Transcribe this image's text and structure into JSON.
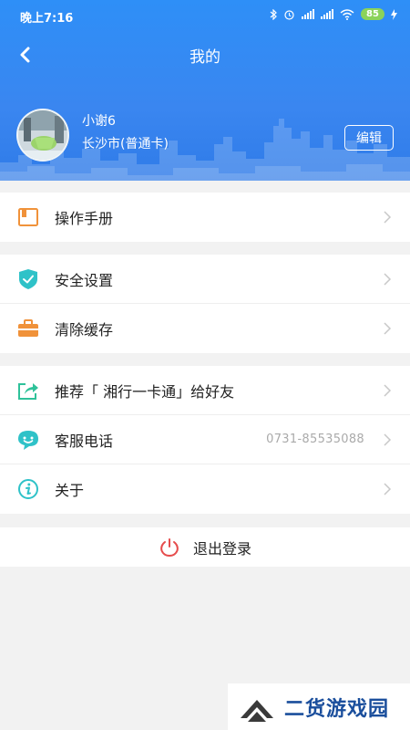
{
  "status_bar": {
    "time": "晚上7:16",
    "battery": "85",
    "icons": [
      "bluetooth-icon",
      "alarm-icon",
      "signal-icon",
      "signal-icon",
      "wifi-icon",
      "battery-icon",
      "charging-icon"
    ]
  },
  "header": {
    "title": "我的",
    "back_icon": "back-arrow-icon"
  },
  "profile": {
    "name": "小谢6",
    "card": "长沙市(普通卡)",
    "edit_label": "编辑"
  },
  "menu_groups": [
    [
      {
        "label": "操作手册",
        "icon": "manual-icon",
        "icon_color": "#f0923a"
      }
    ],
    [
      {
        "label": "安全设置",
        "icon": "shield-icon",
        "icon_color": "#2fc2c8"
      },
      {
        "label": "清除缓存",
        "icon": "briefcase-icon",
        "icon_color": "#f0923a"
      }
    ],
    [
      {
        "label": "推荐「 湘行一卡通」给好友",
        "icon": "share-icon",
        "icon_color": "#2fc29a"
      },
      {
        "label": "客服电话",
        "value": "0731-85535088",
        "icon": "customer-service-icon",
        "icon_color": "#2fc2c8"
      },
      {
        "label": "关于",
        "icon": "info-icon",
        "icon_color": "#2fc2c8"
      }
    ]
  ],
  "logout": {
    "label": "退出登录",
    "icon": "power-icon",
    "icon_color": "#e64c4c"
  },
  "watermark": {
    "text": "二货游戏园"
  },
  "colors": {
    "header_blue": "#3a86f0",
    "page_bg": "#f2f2f2",
    "chevron": "#c8c8c8",
    "value_text": "#aaaaaa"
  }
}
